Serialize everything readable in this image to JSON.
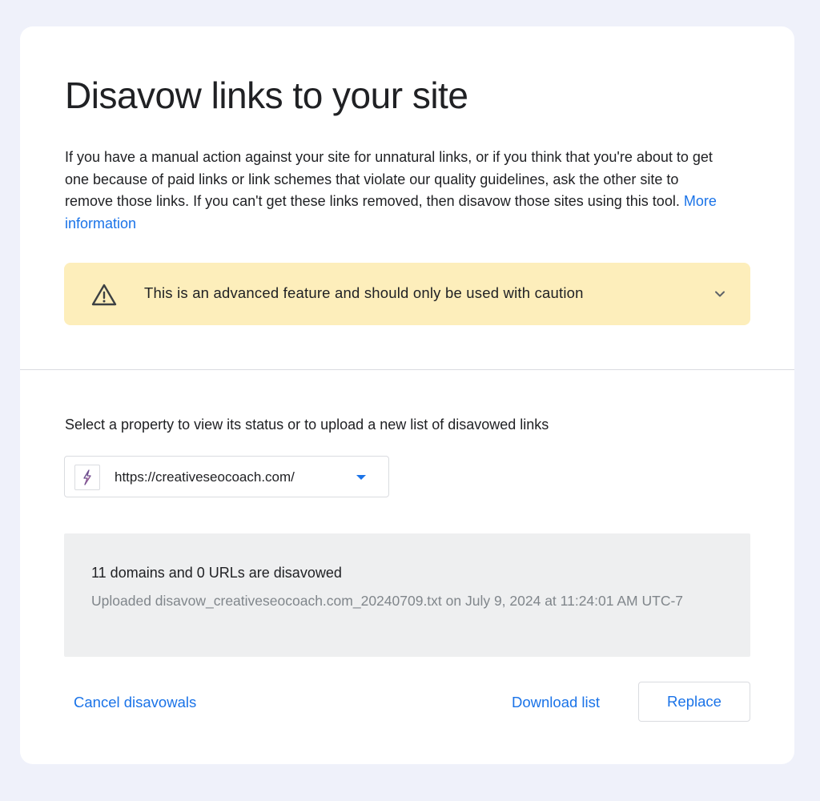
{
  "page": {
    "title": "Disavow links to your site",
    "description": "If you have a manual action against your site for unnatural links, or if you think that you're about to get one because of paid links or link schemes that violate our quality guidelines, ask the other site to remove those links. If you can't get these links removed, then disavow those sites using this tool.",
    "more_info_link": "More information"
  },
  "warning": {
    "icon": "warning-triangle-icon",
    "text": "This is an advanced feature and should only be used with caution",
    "expand_icon": "chevron-down-icon"
  },
  "property_section": {
    "label": "Select a property to view its status or to upload a new list of disavowed links",
    "selected_property": "https://creativeseocoach.com/",
    "favicon": "site-favicon-icon",
    "dropdown_icon": "dropdown-arrow-icon"
  },
  "status": {
    "summary": "11 domains and 0 URLs are disavowed",
    "detail": "Uploaded disavow_creativeseocoach.com_20240709.txt on July 9, 2024 at 11:24:01 AM UTC-7"
  },
  "actions": {
    "cancel_label": "Cancel disavowals",
    "download_label": "Download list",
    "replace_label": "Replace"
  },
  "colors": {
    "background": "#eff1fa",
    "card": "#ffffff",
    "warning_bg": "#fdeebb",
    "link": "#1a73e8",
    "status_bg": "#eeeff0",
    "muted_text": "#80868b"
  }
}
